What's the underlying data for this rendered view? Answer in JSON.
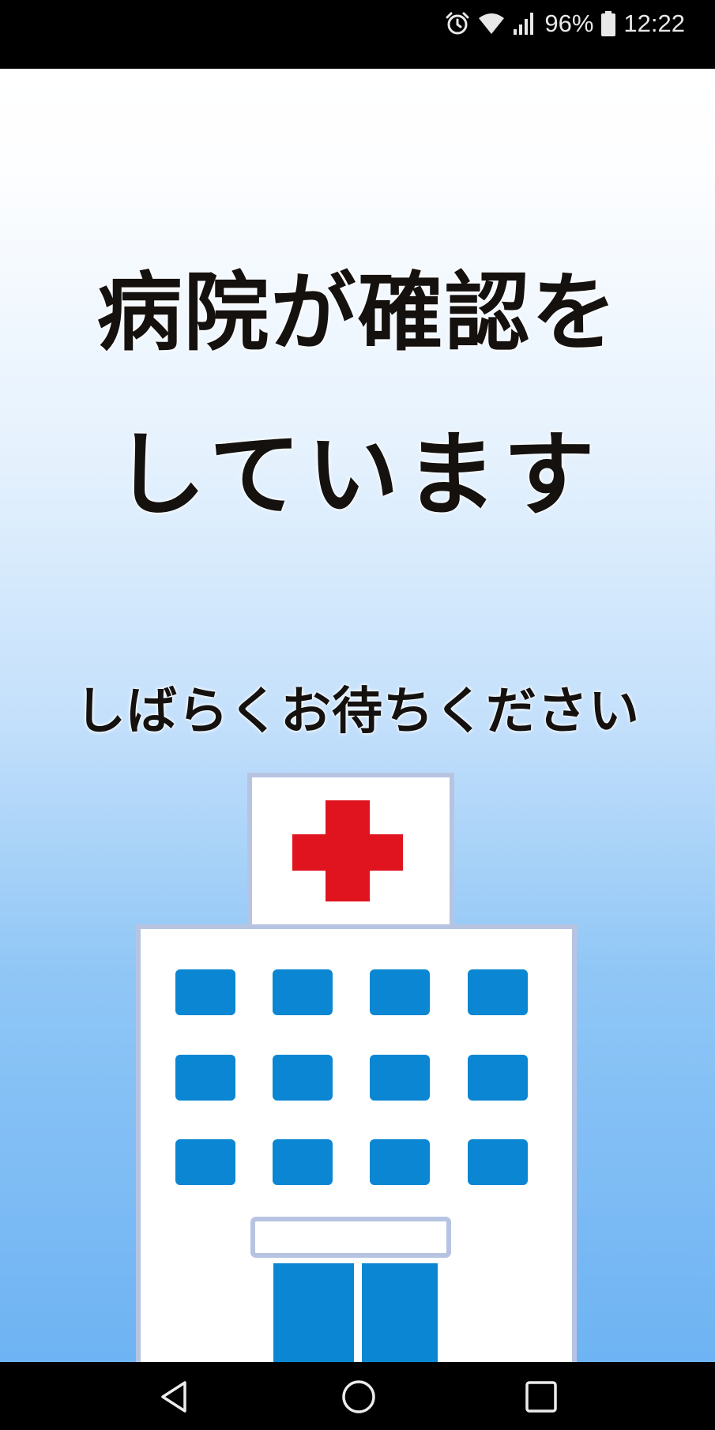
{
  "status_bar": {
    "battery": "96%",
    "time": "12:22",
    "icons": [
      "alarm-icon",
      "wifi-icon",
      "signal-icon",
      "battery-icon"
    ]
  },
  "main": {
    "title_line1": "病院が確認を",
    "title_line2": "しています",
    "subtitle": "しばらくお待ちください",
    "illustration": "hospital-illustration"
  },
  "nav_bar": {
    "icons": [
      "back-icon",
      "home-icon",
      "recent-apps-icon"
    ]
  },
  "colors": {
    "status_bar_bg": "#000000",
    "text": "#14110f",
    "gradient_top": "#ffffff",
    "gradient_bottom": "#6eb3f3",
    "cross_red": "#e0141e",
    "window_blue": "#0a86d2"
  }
}
